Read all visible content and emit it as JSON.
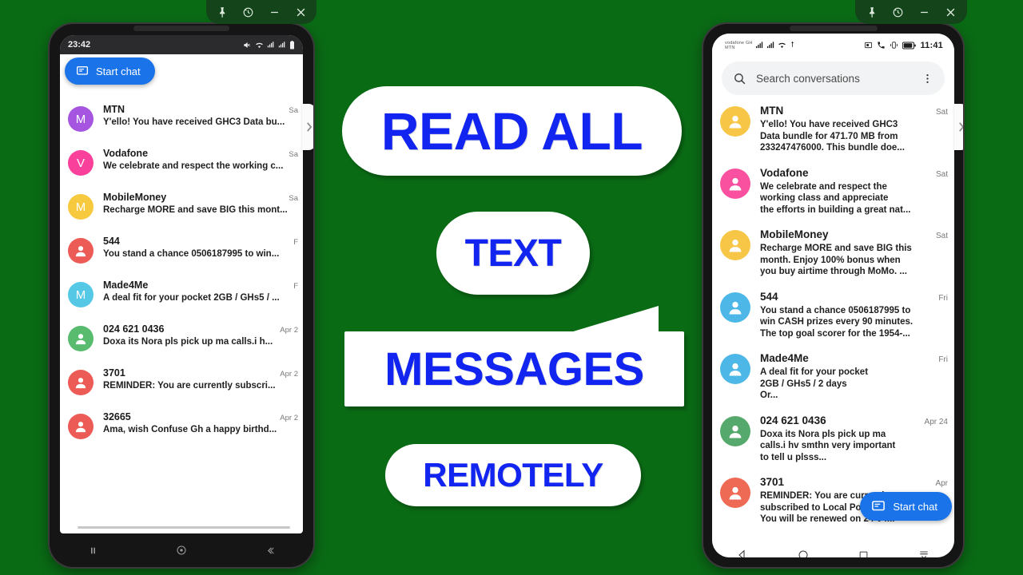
{
  "background_color": "#0a6b15",
  "accent_blue": "#1224ef",
  "window_controls": {
    "left": [
      {
        "name": "pin-icon",
        "label": "Pin"
      },
      {
        "name": "history-icon",
        "label": "History"
      },
      {
        "name": "minimize-icon",
        "label": "Minimize"
      },
      {
        "name": "close-icon",
        "label": "Close"
      }
    ],
    "right": [
      {
        "name": "pin-icon",
        "label": "Pin"
      },
      {
        "name": "history-icon",
        "label": "History"
      },
      {
        "name": "minimize-icon",
        "label": "Minimize"
      },
      {
        "name": "close-icon",
        "label": "Close"
      }
    ]
  },
  "overlay": {
    "line1": "READ ALL",
    "line2": "TEXT",
    "line3": "MESSAGES",
    "line4": "REMOTELY"
  },
  "left_phone": {
    "status_bar": {
      "time": "23:42",
      "icons": [
        "mute-icon",
        "wifi-icon",
        "signal-icon",
        "signal-icon",
        "battery-icon"
      ]
    },
    "fab": {
      "label": "Start chat",
      "icon": "message-icon"
    },
    "side_handle": {
      "icon": "chevron-right-icon"
    },
    "conversations": [
      {
        "name": "MTN",
        "snippet": "Y'ello! You have received GHC3 Data bu...",
        "time": "Sa",
        "avatar_letter": "M",
        "avatar_color": "#a655e0",
        "avatar_type": "letter"
      },
      {
        "name": "Vodafone",
        "snippet": "We celebrate and respect the working c...",
        "time": "Sa",
        "avatar_letter": "V",
        "avatar_color": "#f9409b",
        "avatar_type": "letter"
      },
      {
        "name": "MobileMoney",
        "snippet": "Recharge MORE and save BIG this mont...",
        "time": "Sa",
        "avatar_letter": "M",
        "avatar_color": "#f7c93e",
        "avatar_type": "letter"
      },
      {
        "name": "544",
        "snippet": "You stand a chance 0506187995 to win...",
        "time": "F",
        "avatar_letter": "",
        "avatar_color": "#ec5b56",
        "avatar_type": "person"
      },
      {
        "name": "Made4Me",
        "snippet": "A deal fit for your pocket 2GB / GHs5 / ...",
        "time": "F",
        "avatar_letter": "M",
        "avatar_color": "#55c8e6",
        "avatar_type": "letter"
      },
      {
        "name": "024 621 0436",
        "snippet": "Doxa its Nora pls pick up ma calls.i h...",
        "time": "Apr 2",
        "avatar_letter": "",
        "avatar_color": "#58bb6e",
        "avatar_type": "person"
      },
      {
        "name": "3701",
        "snippet": "REMINDER: You are currently subscri...",
        "time": "Apr 2",
        "avatar_letter": "",
        "avatar_color": "#ec5b56",
        "avatar_type": "person"
      },
      {
        "name": "32665",
        "snippet": "Ama, wish Confuse Gh a happy birthd...",
        "time": "Apr 2",
        "avatar_letter": "",
        "avatar_color": "#ec5b56",
        "avatar_type": "person"
      }
    ],
    "nav_bar": [
      "pause-icon",
      "home-icon",
      "back-icon"
    ]
  },
  "right_phone": {
    "status_bar": {
      "carrier_line1": "vodafone GH",
      "carrier_line2": "MTN",
      "time": "11:41",
      "left_icons": [
        "signal-icon",
        "signal-icon",
        "wifi-icon",
        "sync-icon"
      ],
      "right_icons": [
        "screenshot-icon",
        "call-icon",
        "vibrate-icon",
        "battery-icon"
      ]
    },
    "search": {
      "placeholder": "Search conversations",
      "icon": "search-icon",
      "overflow_icon": "more-vert-icon"
    },
    "fab": {
      "label": "Start chat",
      "icon": "message-icon"
    },
    "side_handle": {
      "icon": "chevron-right-icon"
    },
    "conversations": [
      {
        "name": "MTN",
        "snippet": "Y'ello! You have received GHC3\nData bundle for 471.70 MB from\n233247476000. This bundle doe...",
        "time": "Sat",
        "avatar_color": "#f7c646",
        "avatar_type": "person"
      },
      {
        "name": "Vodafone",
        "snippet": "We celebrate and respect the\nworking class and appreciate\nthe efforts in building a great nat...",
        "time": "Sat",
        "avatar_color": "#f9509f",
        "avatar_type": "person"
      },
      {
        "name": "MobileMoney",
        "snippet": "Recharge MORE and save BIG this\nmonth. Enjoy 100% bonus when\nyou buy airtime through MoMo. ...",
        "time": "Sat",
        "avatar_color": "#f7c646",
        "avatar_type": "person"
      },
      {
        "name": "544",
        "snippet": "You stand a chance 0506187995 to\nwin CASH prizes every 90 minutes.\nThe top goal scorer for the 1954-...",
        "time": "Fri",
        "avatar_color": "#4db8e8",
        "avatar_type": "person"
      },
      {
        "name": "Made4Me",
        "snippet": "A deal fit for your pocket\n2GB / GHs5 / 2 days\nOr...",
        "time": "Fri",
        "avatar_color": "#4db8e8",
        "avatar_type": "person"
      },
      {
        "name": "024 621 0436",
        "snippet": "Doxa its Nora pls pick up ma\ncalls.i hv smthn very important\nto tell u plsss...",
        "time": "Apr 24",
        "avatar_color": "#56a96c",
        "avatar_type": "person"
      },
      {
        "name": "3701",
        "snippet": "REMINDER: You are currently\nsubscribed to Local Pondster.\nYou will be renewed on 24-04...",
        "time": "Apr",
        "avatar_color": "#ee6a55",
        "avatar_type": "person"
      }
    ],
    "nav_bar": [
      "back-triangle-icon",
      "home-circle-icon",
      "recents-square-icon",
      "hide-nav-icon"
    ]
  }
}
